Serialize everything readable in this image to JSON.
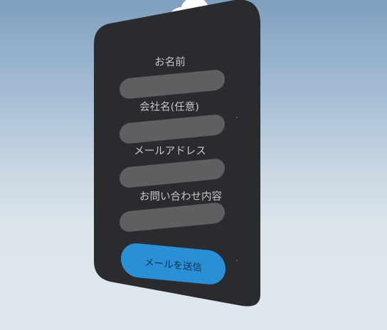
{
  "form": {
    "fields": [
      {
        "label": "お名前",
        "value": ""
      },
      {
        "label": "会社名(任意)",
        "value": ""
      },
      {
        "label": "メールアドレス",
        "value": ""
      },
      {
        "label": "お問い合わせ内容",
        "value": ""
      }
    ],
    "submit_label": "メールを送信"
  },
  "colors": {
    "panel": "#2a2b2f",
    "input": "#5f5f61",
    "label": "#c6c6c6",
    "submit": "#2b8fd6",
    "submit_text": "#16314a",
    "sky_top": "#7f9fbf",
    "sky_bottom": "#dfe7ee"
  }
}
